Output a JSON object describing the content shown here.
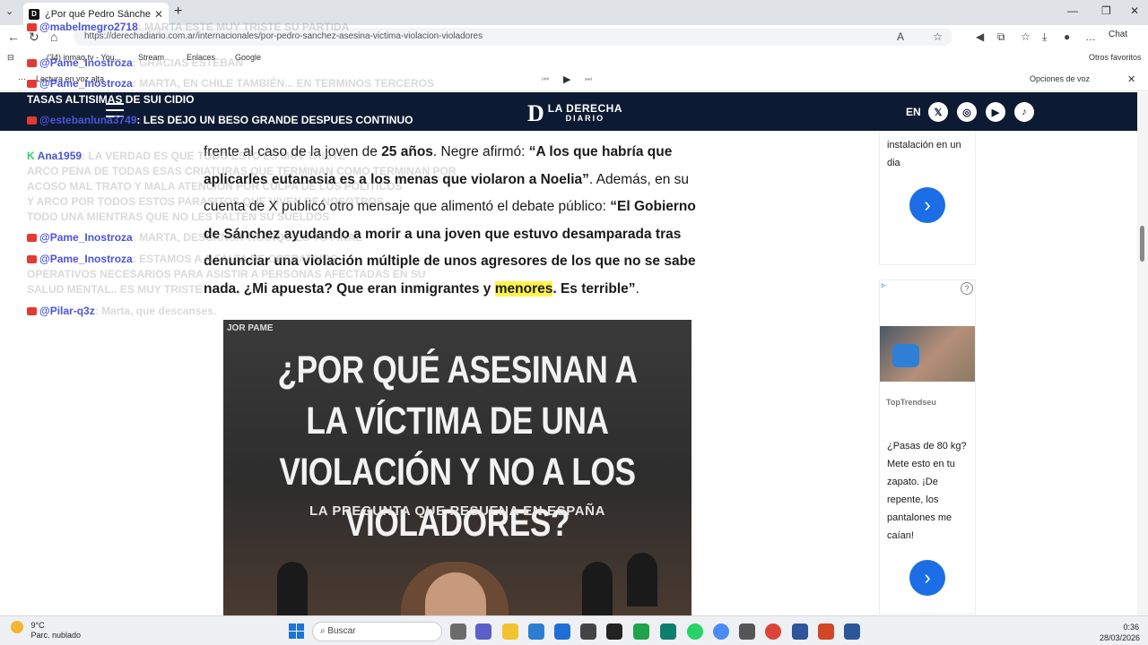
{
  "browser": {
    "tab_title": "¿Por qué Pedro Sánchez asesinó a",
    "url": "https://derechadiario.com.ar/internacionales/por-pedro-sanchez-asesina-victima-violacion-violadores",
    "chat_label": "Chat",
    "bookmarks": [
      {
        "label": "(34) inmaq tv - You..."
      },
      {
        "label": "Stream"
      },
      {
        "label": "Enlaces"
      },
      {
        "label": "Google"
      }
    ],
    "other_favorites": "Otros favoritos",
    "read_aloud": "Lectura en voz alta",
    "voice_options": "Opciones de voz"
  },
  "site": {
    "logo_line1": "LA DERECHA",
    "logo_line2": "DIARIO",
    "lang": "EN"
  },
  "article": {
    "p1a": "frente al caso de la joven de ",
    "p1b": "25 años",
    "p1c": ". Negre afirmó: ",
    "q1": "“A los que habría que aplicarles eutanasia es a los menas que violaron a Noelia”",
    "p1d": ". Además, en su cuenta de X publicó otro mensaje que alimentó el debate público: ",
    "q2a": "“El Gobierno de Sánchez ayudando a morir a una joven que estuvo desamparada tras denunciar una violación múltiple de unos agresores de los que no se sabe nada. ¿Mi apuesta? Que eran inmigrantes y ",
    "q2hl": "menores",
    "q2b": ". Es terrible”",
    "p_end": "."
  },
  "hero_image": {
    "corner_text": "JOR PAME",
    "headline": "¿POR QUÉ ASESINAN A LA VÍCTIMA DE UNA VIOLACIÓN Y NO A LOS VIOLADORES?",
    "subhead": "LA PREGUNTA QUE RESUENA EN ESPAÑA"
  },
  "ads": {
    "ad1_text": "instalación en un dia",
    "ad2_source": "TopTrendseu",
    "ad2_text": "¿Pasas de 80 kg? Mete esto en tu zapato. ¡De repente, los pantalones me caían!"
  },
  "chat": {
    "lines": [
      {
        "user": "@mabelmegro2718",
        "msg": "MARTA ESTE MUY TRISTE SU PARTIDA"
      },
      {
        "user": "@Pame_Inostroza",
        "msg": "GRACIAS ESTEBAN"
      },
      {
        "user": "@Pame_Inostroza",
        "msg": "MARTA, EN CHILE TAMBIÉN... EN TERMINOS TERCEROS"
      },
      {
        "user": "",
        "msg": "TASAS ALTISIMAS DE SUI CIDIO"
      },
      {
        "user": "@estebanluna3749",
        "msg": "LES DEJO UN BESO GRANDE DESPUES CONTINUO"
      },
      {
        "user": "Ana1959",
        "msg": "LA VERDAD ES QUE TODO ESTO ES MUY TRISTE"
      },
      {
        "user": "",
        "msg": "ARCO PENA DE TODAS ESAS CRIATURAS QUE TERMINAN COMO TERMINAN POR"
      },
      {
        "user": "",
        "msg": "ACOSO MAL TRATO Y MALA ATENCION POR CULPA DE LOS POLITICOS"
      },
      {
        "user": "",
        "msg": "Y ARCO POR TODOS ESTOS PARASITOS QUE VIVEN DE NOSOTROS"
      },
      {
        "user": "",
        "msg": "TODO UNA MIENTRAS QUE NO LES FALTEN SU SUELDOS"
      },
      {
        "user": "@Pame_Inostroza",
        "msg": "MARTA, DESCANSA TRANQUILO TU FINAL"
      },
      {
        "user": "@Pame_Inostroza",
        "msg": "ESTAMOS A A FALTA DE OPERATIVOS"
      },
      {
        "user": "",
        "msg": "OPERATIVOS NECESARIOS PARA ASISTIR A PERSONAS AFECTADAS EN SU"
      },
      {
        "user": "",
        "msg": "SALUD MENTAL.. ES MUY TRISTE"
      },
      {
        "user": "@Pilar-q3z",
        "msg": "Marta, que descanses."
      }
    ]
  },
  "taskbar": {
    "temp": "9°C",
    "weather": "Parc. nublado",
    "search_placeholder": "Buscar",
    "time": "0:36",
    "date": "28/03/2026"
  }
}
